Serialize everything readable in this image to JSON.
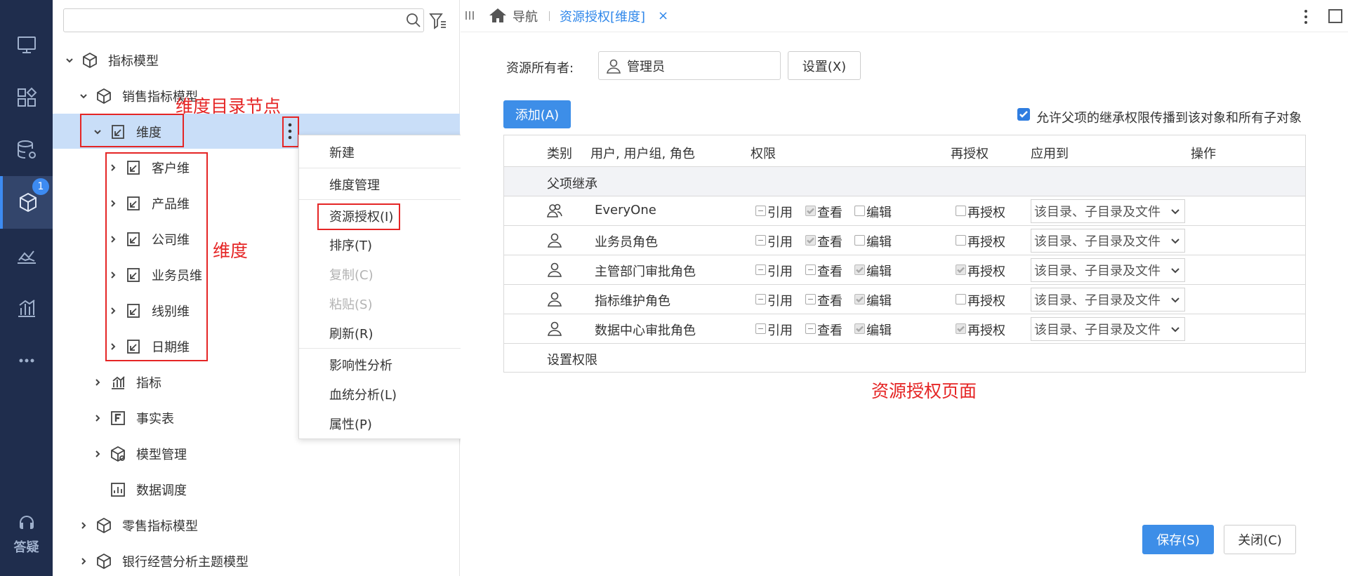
{
  "rail": {
    "help_label": "答疑",
    "badge_count": "1",
    "accent_color": "#3d8bf2",
    "icons": [
      "monitor-icon",
      "apps-icon",
      "database-settings-icon",
      "model-cube-icon",
      "chart-landscape-icon",
      "bar-chart-icon",
      "more-dots-icon"
    ]
  },
  "tree": {
    "search_placeholder": "",
    "nodes": {
      "root": "指标模型",
      "sales_model": "销售指标模型",
      "dimension": "维度",
      "customer_dim": "客户维",
      "product_dim": "产品维",
      "company_dim": "公司维",
      "salesman_dim": "业务员维",
      "line_dim": "线别维",
      "date_dim": "日期维",
      "metrics": "指标",
      "fact_table": "事实表",
      "model_mgmt": "模型管理",
      "data_schedule": "数据调度",
      "retail_model": "零售指标模型",
      "bank_model": "银行经营分析主题模型"
    }
  },
  "annotations": {
    "dimension_node": "维度目录节点",
    "dimensions": "维度",
    "auth_page": "资源授权页面",
    "color": "#e52525"
  },
  "context_menu": {
    "items": {
      "new": "新建",
      "dim_manage": "维度管理",
      "resource_auth": "资源授权(I)",
      "sort": "排序(T)",
      "copy": "复制(C)",
      "paste": "粘贴(S)",
      "refresh": "刷新(R)",
      "impact": "影响性分析",
      "lineage": "血统分析(L)",
      "properties": "属性(P)"
    }
  },
  "topbar": {
    "nav_label": "导航",
    "active_tab": "资源授权[维度]",
    "close_glyph": "×"
  },
  "auth": {
    "owner_label": "资源所有者:",
    "owner_value": "管理员",
    "set_button": "设置(X)",
    "add_button": "添加(A)",
    "inherit_label": "允许父项的继承权限传播到该对象和所有子对象",
    "inherit_checked": true,
    "columns": {
      "category": "类别",
      "subject": "用户, 用户组, 角色",
      "permission": "权限",
      "regrant": "再授权",
      "apply_to": "应用到",
      "action": "操作"
    },
    "group_label": "父项继承",
    "perm_labels": {
      "ref": "引用",
      "view": "查看",
      "edit": "编辑",
      "regrant": "再授权"
    },
    "rows": [
      {
        "name": "EveryOne",
        "icon": "group-icon",
        "ref": "indeterminate",
        "view": "checked",
        "edit": "unchecked",
        "regrant": "unchecked",
        "apply": "该目录、子目录及文件"
      },
      {
        "name": "业务员角色",
        "icon": "user-icon",
        "ref": "indeterminate",
        "view": "checked",
        "edit": "unchecked",
        "regrant": "unchecked",
        "apply": "该目录、子目录及文件"
      },
      {
        "name": "主管部门审批角色",
        "icon": "user-icon",
        "ref": "indeterminate",
        "view": "indeterminate",
        "edit": "checked",
        "regrant": "checked",
        "apply": "该目录、子目录及文件"
      },
      {
        "name": "指标维护角色",
        "icon": "user-icon",
        "ref": "indeterminate",
        "view": "indeterminate",
        "edit": "checked",
        "regrant": "unchecked",
        "apply": "该目录、子目录及文件"
      },
      {
        "name": "数据中心审批角色",
        "icon": "user-icon",
        "ref": "indeterminate",
        "view": "indeterminate",
        "edit": "checked",
        "regrant": "checked",
        "apply": "该目录、子目录及文件"
      }
    ],
    "set_permission_label": "设置权限",
    "save_button": "保存(S)",
    "close_button": "关闭(C)"
  }
}
